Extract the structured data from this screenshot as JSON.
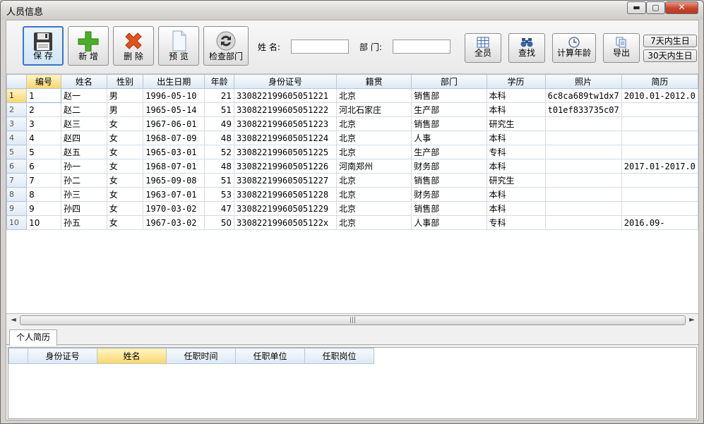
{
  "window": {
    "title": "人员信息",
    "min_glyph": "▬",
    "max_glyph": "▢",
    "close_glyph": "✕"
  },
  "toolbar": {
    "save_label": "保 存",
    "add_label": "新 增",
    "delete_label": "删 除",
    "preview_label": "预 览",
    "check_dept_label": "检查部门",
    "name_label": "姓 名:",
    "name_value": "",
    "dept_label": "部 门:",
    "dept_value": "",
    "all_label": "全员",
    "find_label": "查找",
    "calc_age_label": "计算年龄",
    "export_label": "导出",
    "birthday7_label": "7天内生日",
    "birthday30_label": "30天内生日"
  },
  "grid": {
    "columns": [
      "编号",
      "姓名",
      "性别",
      "出生日期",
      "年龄",
      "身份证号",
      "籍贯",
      "部门",
      "学历",
      "照片",
      "简历"
    ],
    "rows": [
      [
        "1",
        "1",
        "赵一",
        "男",
        "1996-05-10",
        "21",
        "330822199605051221",
        "北京",
        "销售部",
        "本科",
        "6c8ca689tw1dx7",
        "2010.01-2012.0"
      ],
      [
        "2",
        "2",
        "赵二",
        "男",
        "1965-05-14",
        "51",
        "330822199605051222",
        "河北石家庄",
        "生产部",
        "本科",
        "t01ef833735c07",
        ""
      ],
      [
        "3",
        "3",
        "赵三",
        "女",
        "1967-06-01",
        "49",
        "330822199605051223",
        "北京",
        "销售部",
        "研究生",
        "",
        ""
      ],
      [
        "4",
        "4",
        "赵四",
        "女",
        "1968-07-09",
        "48",
        "330822199605051224",
        "北京",
        "人事",
        "本科",
        "",
        ""
      ],
      [
        "5",
        "5",
        "赵五",
        "女",
        "1965-03-01",
        "52",
        "330822199605051225",
        "北京",
        "生产部",
        "专科",
        "",
        ""
      ],
      [
        "6",
        "6",
        "孙一",
        "女",
        "1968-07-01",
        "48",
        "330822199605051226",
        "河南郑州",
        "财务部",
        "本科",
        "",
        "2017.01-2017.0"
      ],
      [
        "7",
        "7",
        "孙二",
        "女",
        "1965-09-08",
        "51",
        "330822199605051227",
        "北京",
        "销售部",
        "研究生",
        "",
        ""
      ],
      [
        "8",
        "8",
        "孙三",
        "女",
        "1963-07-01",
        "53",
        "330822199605051228",
        "北京",
        "财务部",
        "本科",
        "",
        ""
      ],
      [
        "9",
        "9",
        "孙四",
        "女",
        "1970-03-02",
        "47",
        "330822199605051229",
        "北京",
        "销售部",
        "本科",
        "",
        ""
      ],
      [
        "10",
        "10",
        "孙五",
        "女",
        "1967-03-02",
        "50",
        "33082219960505122x",
        "北京",
        "人事部",
        "专科",
        "",
        "2016.09-"
      ]
    ]
  },
  "scrollbar": {
    "left_arrow": "◄",
    "right_arrow": "►",
    "grip": "|||"
  },
  "detail": {
    "tab_label": "个人简历",
    "columns": [
      "身份证号",
      "姓名",
      "任职时间",
      "任职单位",
      "任职岗位"
    ]
  },
  "colors": {
    "selected_header": "#fad66c",
    "header": "#dde8f4",
    "accent_border": "#3a76c6"
  }
}
